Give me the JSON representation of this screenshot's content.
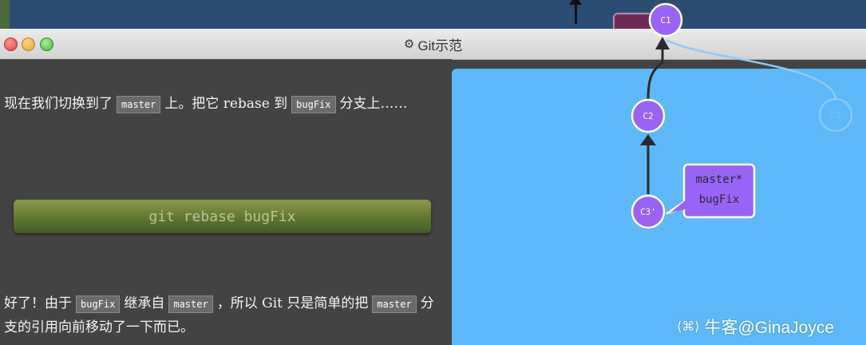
{
  "window": {
    "title": "Git示范"
  },
  "lesson": {
    "paragraph1": {
      "before_master": "现在我们切换到了",
      "code_master": "master",
      "middle": "上。把它 rebase 到",
      "code_bugfix": "bugFix",
      "after": "分支上……"
    },
    "command": "git rebase bugFix",
    "paragraph2": {
      "p1": "好了！由于",
      "code_bugfix": "bugFix",
      "p2": "继承自",
      "code_master": "master",
      "p3": "，所以 Git 只是简单的把",
      "code_master2": "master",
      "p4": "分支的引用向前移动了一下而已。"
    }
  },
  "graph": {
    "nodes": {
      "c1": "C1",
      "c2": "C2",
      "c3": "C3",
      "c3_prime": "C3'"
    },
    "branch_tag": {
      "line1": "master*",
      "line2": "bugFix"
    }
  },
  "watermark": "牛客@GinaJoyce",
  "colors": {
    "canvas": "#5db9f9",
    "commit": "#9a63f7",
    "panel": "#434343",
    "command_button": "#6b7d35"
  }
}
